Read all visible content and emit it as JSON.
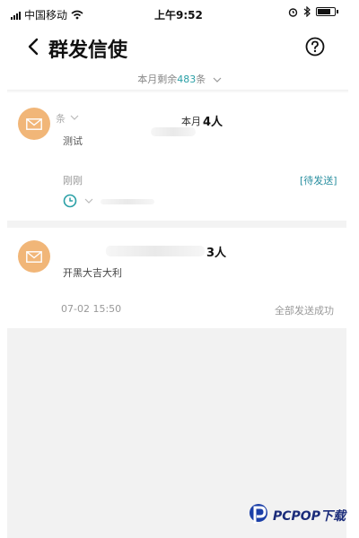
{
  "status_bar": {
    "carrier": "中国移动",
    "time": "上午9:52"
  },
  "navbar": {
    "title": "群发信使"
  },
  "quota": {
    "prefix": "本月剩余",
    "number": "483",
    "suffix": "条"
  },
  "messages": [
    {
      "prefix": "条",
      "month_label": "本月",
      "recipients": "4人",
      "content": "测试",
      "time": "刚刚",
      "status": "[待发送]"
    },
    {
      "recipients": "3人",
      "content": "开黑大吉大利",
      "time": "07-02 15:50",
      "status": "全部发送成功"
    }
  ],
  "watermark": {
    "text": "PCPOP下载"
  },
  "colors": {
    "avatar_bg": "#f1b678",
    "accent_teal": "#2aa0a6",
    "empty_bg": "#f2f2f2"
  },
  "icons": [
    "back-icon",
    "help-icon",
    "mail-icon",
    "clock-icon",
    "chevron-down-icon",
    "wifi-icon",
    "alarm-icon",
    "bluetooth-icon",
    "battery-icon"
  ]
}
